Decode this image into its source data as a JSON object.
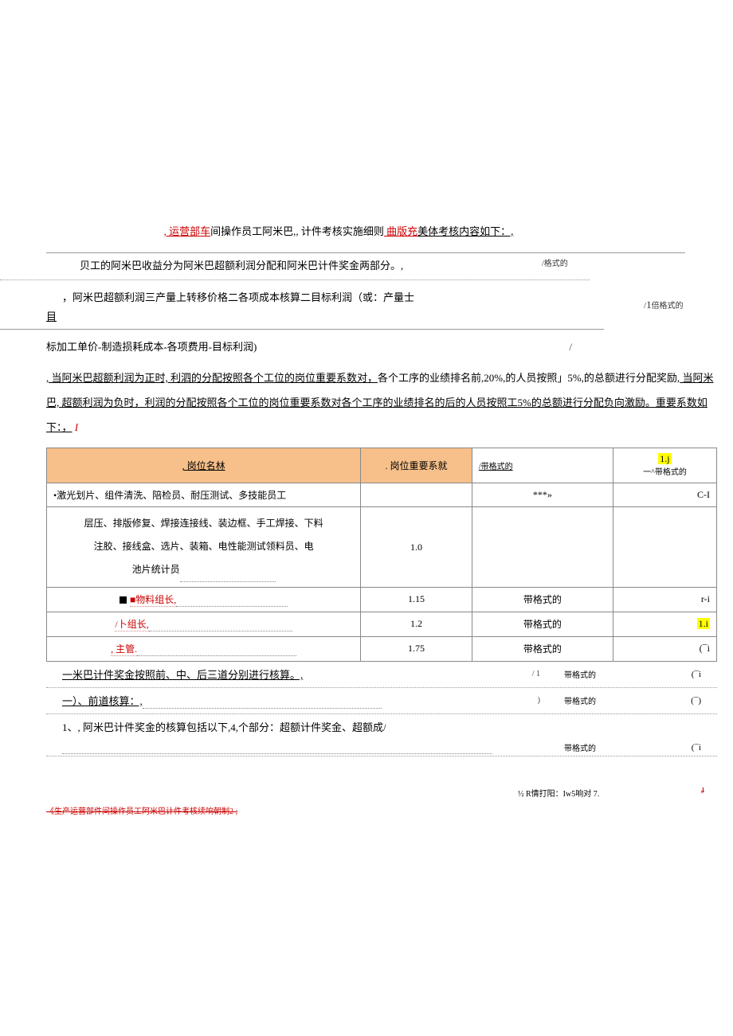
{
  "title": {
    "part1": ", 运营部车",
    "part2": "间操作员工阿米巴,, 计件考核实施细则",
    "part3": " 曲版充",
    "part4": "美体考核内容如下：,",
    "trailing": ""
  },
  "lines": {
    "l1_pre": "贝工的阿米巴收益分为阿米巴超额利润分配和阿米巴计件奖金两部分。,",
    "note_top1": "/格式的",
    "l2": "，阿米巴超额利润三产量上转移价格二各项成本核算二目标利润（或：产量士",
    "l2_suffix": "目",
    "note_top2": "/1倍格式的",
    "l3": "标加工单价-制造损耗成本-各项费用-目标利润)",
    "para1": ", 当阿米巴超额利润为正时, 利泗的分配按照各个工位的岗位重要系数对，",
    "para1b": "各个工序的业绩排名前,20%,的人员按照」5%,的总额进行分配奖励,",
    "para1c": " 当阿米巴, 超额利润为负时，利润的分配按照各个工位的岗位重要系数对各个工序的业绩排名的后",
    "para1d": "的人员按照工5%的总额进行分配负向激励。重要系数如下：，",
    "para1d_trail": "I"
  },
  "table": {
    "headers": {
      "name": ", 岗位名林",
      "coef": ". 岗位重要系就",
      "note1": "/带格式的",
      "note2_a": "1.j",
      "note2_b": "一^带格式的"
    },
    "rows": [
      {
        "name": "•激光划片、组件清洗、陪检员、耐压测试、多技能员工",
        "coef": "",
        "note1": "***»",
        "note2": "C-I"
      },
      {
        "name_multi": "层压、排版修复、焊接连接线、装边框、手工焊接、下料\n注胶、接线盒、选片、装箱、电性能测试领料员、电\n池片统计员",
        "coef": "1.0",
        "note1": "",
        "note2": ""
      },
      {
        "name": "■物料组长,",
        "coef": "1.15",
        "note1": "带格式的",
        "note2": "r-i"
      },
      {
        "name": "/卜组长,",
        "coef": "1.2",
        "note1": "带格式的",
        "note2": "1.i",
        "hl": true
      },
      {
        "name": ", 主管.",
        "coef": "1.75",
        "note1": "带格式的",
        "note2": "(¯i"
      }
    ]
  },
  "post": [
    {
      "left": "一米巴计件奖金按照前、中、后三道分别进行核算。,",
      "mid": "/ 1",
      "label": "带格式的",
      "right": "(¯i"
    },
    {
      "left": "一）、前道核算：,",
      "mid": ")",
      "label": "带格式的",
      "right": "(¯)"
    },
    {
      "left": "1、, 阿米巴计件奖金的核算包括以下,4,个部分：超额计件奖金、超额成/",
      "mid": "",
      "label": "带格式的",
      "right": "(¯i"
    }
  ],
  "footer": {
    "strike": "《生产运营部件间操作员工阿米巴计件考核续响朝制2 ;",
    "right_main": "½ R情打阳：Iw5响对 7.",
    "right_j": "J"
  }
}
